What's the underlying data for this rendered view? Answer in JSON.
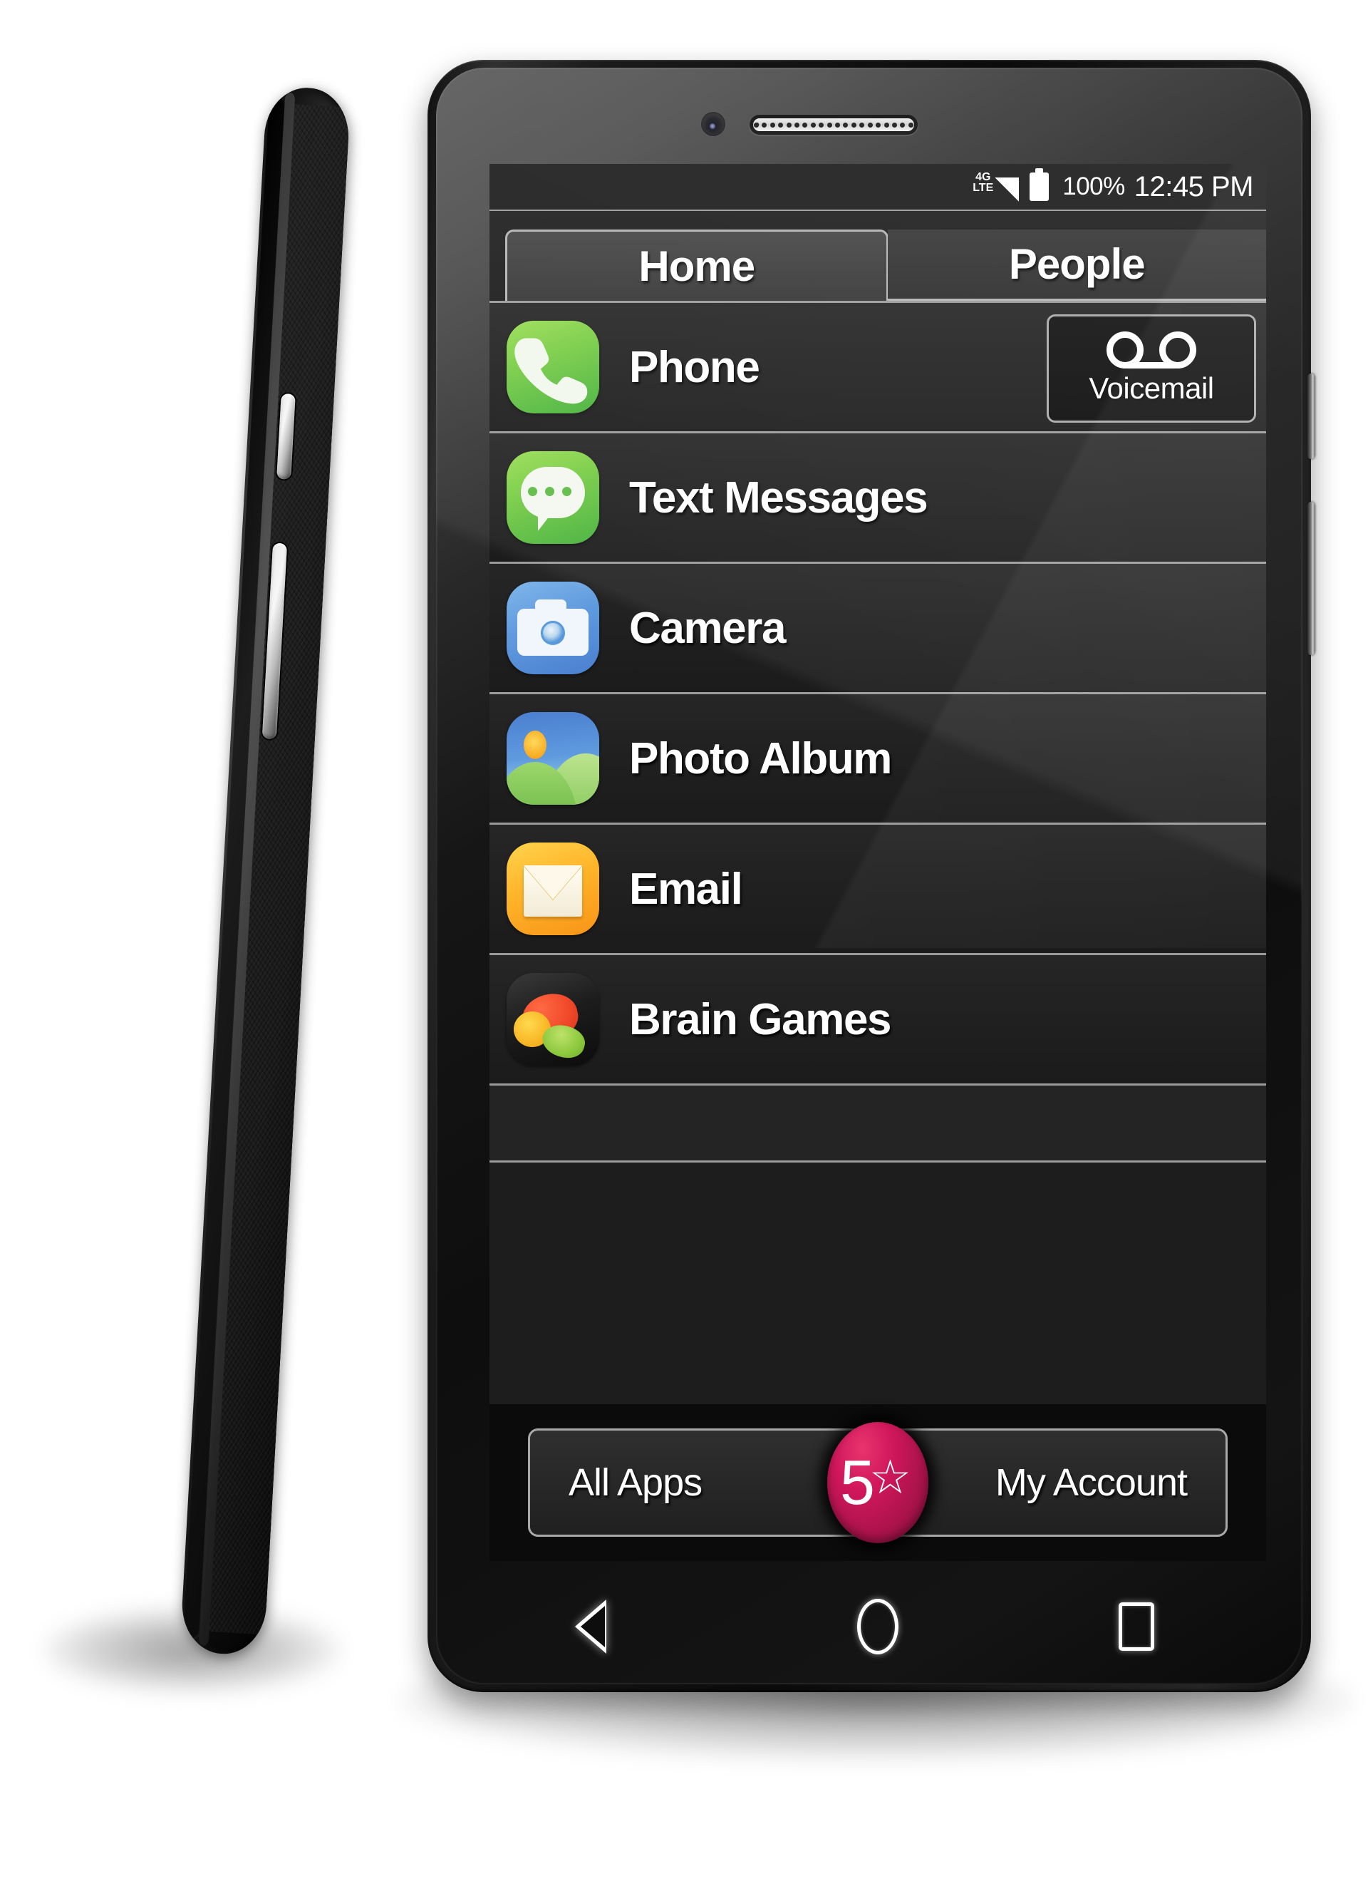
{
  "status_bar": {
    "network_label_top": "4G",
    "network_label_bottom": "LTE",
    "signal_icon": "signal-bars-icon",
    "battery_icon": "battery-full-icon",
    "battery_percent": "100%",
    "clock": "12:45 PM"
  },
  "tabs": [
    {
      "label": "Home",
      "active": true
    },
    {
      "label": "People",
      "active": false
    }
  ],
  "apps": [
    {
      "label": "Phone",
      "icon": "phone-icon"
    },
    {
      "label": "Text Messages",
      "icon": "message-bubble-icon"
    },
    {
      "label": "Camera",
      "icon": "camera-icon"
    },
    {
      "label": "Photo Album",
      "icon": "photo-landscape-icon"
    },
    {
      "label": "Email",
      "icon": "envelope-icon"
    },
    {
      "label": "Brain Games",
      "icon": "brain-icon"
    }
  ],
  "voicemail": {
    "label": "Voicemail",
    "icon": "voicemail-tape-icon"
  },
  "bottom_bar": {
    "left_label": "All Apps",
    "right_label": "My Account",
    "badge_number": "5",
    "badge_star": "☆",
    "badge_name": "five-star-logo"
  },
  "nav_bar": {
    "back": "back-triangle-icon",
    "home": "home-circle-icon",
    "recent": "recents-square-icon"
  },
  "hardware": {
    "front_camera": "front-camera-lens",
    "earpiece": "earpiece-speaker-grille",
    "side_button_upper": "power-button",
    "side_button_lower": "volume-rocker"
  },
  "colors": {
    "screen_bg": "#1d1d1d",
    "status_bar_bg": "#1c1c1c",
    "row_divider": "#9b9b9b",
    "accent_badge": "#d0175b",
    "icon_green": "#77cc45",
    "icon_blue": "#5f9ade",
    "icon_orange": "#ffb429",
    "text": "#ffffff"
  }
}
